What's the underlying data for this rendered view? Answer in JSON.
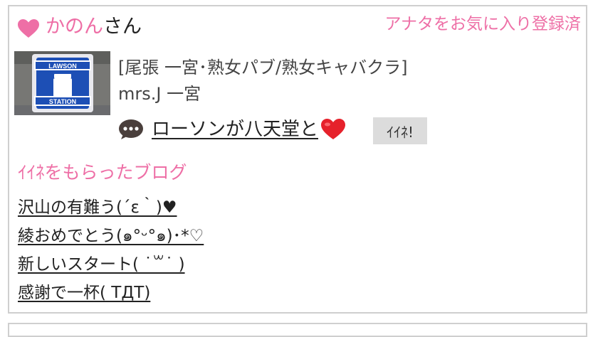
{
  "user": {
    "name": "かのん",
    "suffix": "さん"
  },
  "favorite_status": "アナタをお気に入り登録済",
  "thumbnail": {
    "top_text": "LAWSON",
    "bottom_text": "STATION"
  },
  "shop": {
    "category": "[尾張 一宮･熟女パブ/熟女キャバクラ]",
    "name": "mrs.J 一宮"
  },
  "post": {
    "title": "ローソンが八天堂と"
  },
  "like_button_label": "ｲｲﾈ!",
  "liked_blogs": {
    "heading": "ｲｲﾈをもらったブログ",
    "items": [
      {
        "title": "沢山の有難う(´ε｀)♥"
      },
      {
        "title": "綾おめでとう(๑°ᵕ°๑)･*♡"
      },
      {
        "title": "新しいスタート( ˙꒳˙ )"
      },
      {
        "title": "感謝で一杯( ΤДΤ)"
      }
    ]
  },
  "colors": {
    "accent_pink": "#ee6fa6",
    "border": "#cfcfcf",
    "button_bg": "#dcdcdc",
    "logo_blue": "#1d4fb5"
  }
}
